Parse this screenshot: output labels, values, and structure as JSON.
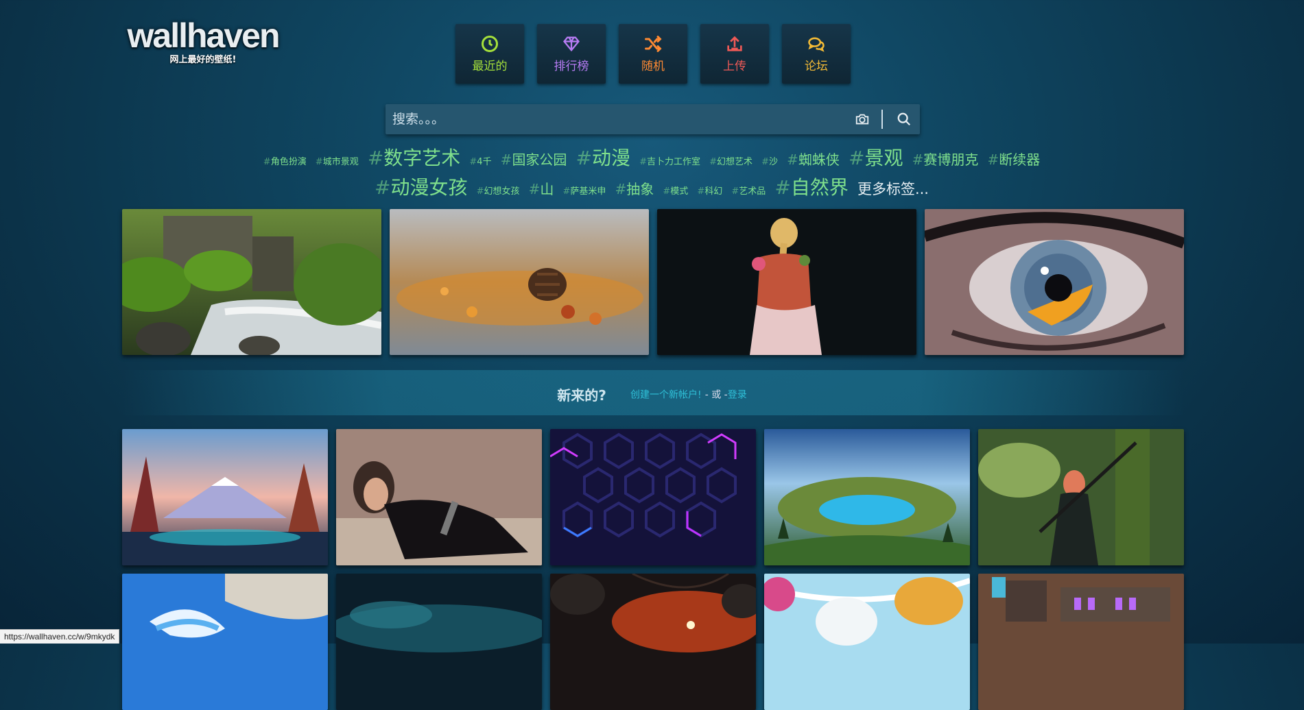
{
  "logo": {
    "text": "wallhaven",
    "subtitle": "网上最好的壁纸!"
  },
  "nav": [
    {
      "label": "最近的",
      "icon": "clock-icon",
      "color": "#a6e13b"
    },
    {
      "label": "排行榜",
      "icon": "diamond-icon",
      "color": "#b77cf4"
    },
    {
      "label": "随机",
      "icon": "shuffle-icon",
      "color": "#ff8a33"
    },
    {
      "label": "上传",
      "icon": "upload-icon",
      "color": "#ef5a57"
    },
    {
      "label": "论坛",
      "icon": "comments-icon",
      "color": "#f4bb36"
    }
  ],
  "search": {
    "placeholder": "搜索。。。",
    "camera_icon": "camera-icon",
    "search_icon": "magnifier-icon"
  },
  "tags": [
    "角色扮演",
    "城市景观",
    "数字艺术",
    "4千",
    "国家公园",
    "动漫",
    "吉卜力工作室",
    "幻想艺术",
    "沙",
    "蜘蛛侠",
    "景观",
    "赛博朋克",
    "断续器",
    "动漫女孩",
    "幻想女孩",
    "山",
    "萨基米申",
    "抽象",
    "模式",
    "科幻",
    "艺术品",
    "自然界"
  ],
  "more_tags": "更多标签...",
  "featured": [
    {
      "subject": "mossy stream and stone mill"
    },
    {
      "subject": "pine cone on autumn leaves"
    },
    {
      "subject": "anime girl with flower braid"
    },
    {
      "subject": "close-up painted eye"
    }
  ],
  "welcome": {
    "question": "新来的?",
    "create_link": "创建一个新帐户!",
    "or_text": "- 或 -",
    "login_link": "登录"
  },
  "grid": [
    {
      "subject": "mountain lake landscape art"
    },
    {
      "subject": "woman in black dress portrait"
    },
    {
      "subject": "neon hexagon pattern"
    },
    {
      "subject": "crater lake landscape"
    },
    {
      "subject": "swordswoman in forest"
    },
    {
      "subject": "ocean wave art"
    },
    {
      "subject": "dark teal clouds"
    },
    {
      "subject": "red planet eclipse"
    },
    {
      "subject": "white tree autumn art"
    },
    {
      "subject": "pixel art machinery"
    }
  ],
  "status_url": "https://wallhaven.cc/w/9mkydk"
}
